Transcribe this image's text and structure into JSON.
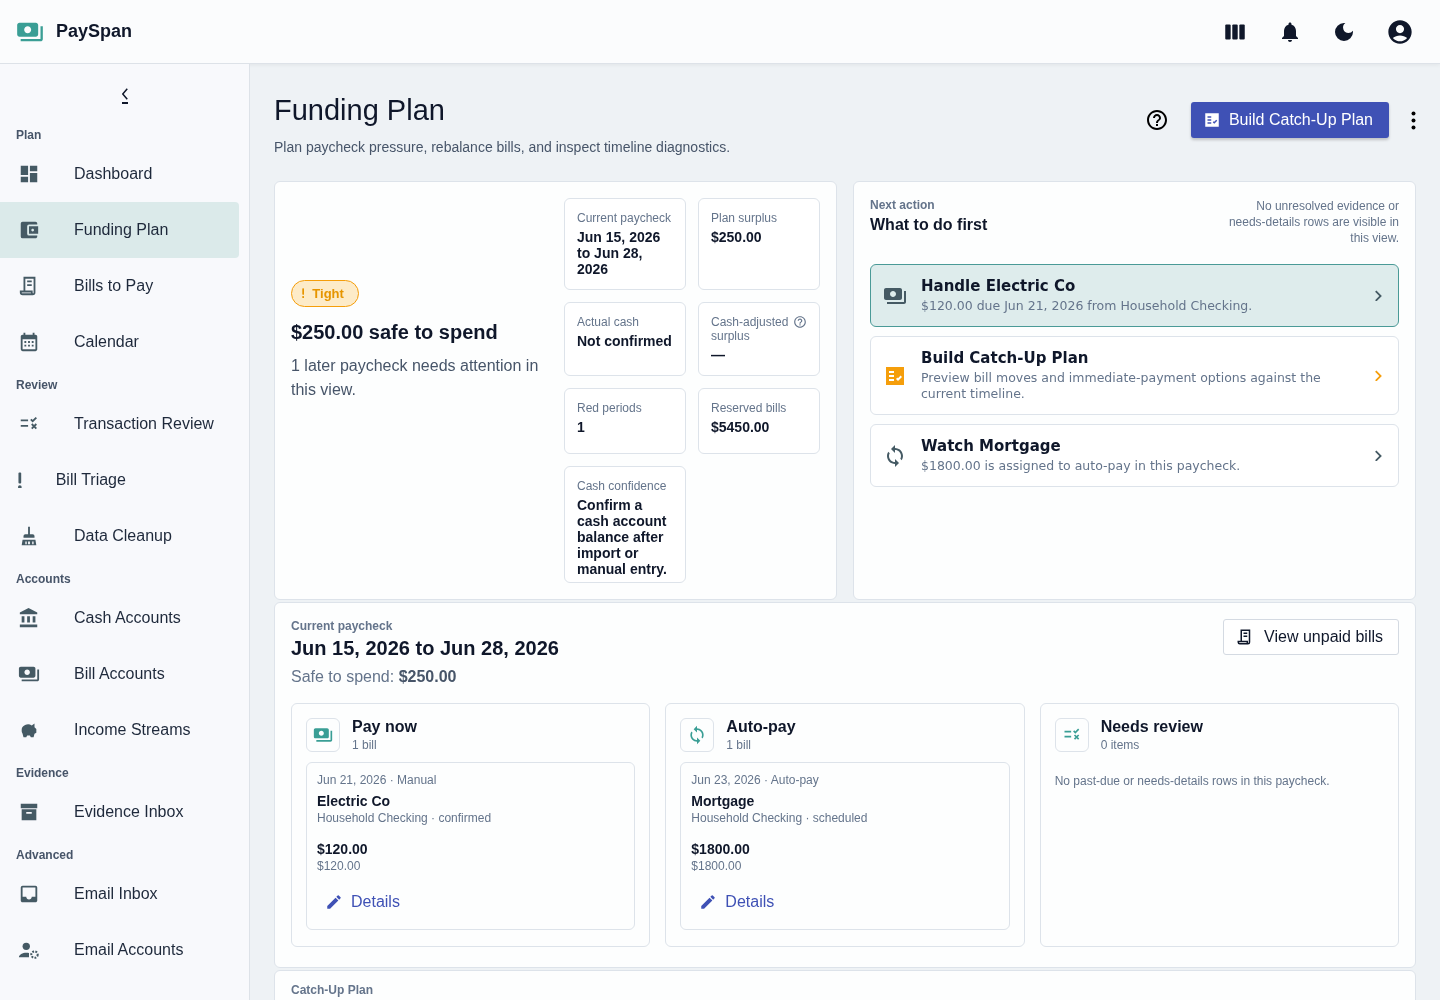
{
  "app": {
    "name": "PaySpan"
  },
  "sidebar": {
    "sections": [
      {
        "label": "Plan",
        "items": [
          {
            "label": "Dashboard",
            "selected": false
          },
          {
            "label": "Funding Plan",
            "selected": true
          },
          {
            "label": "Bills to Pay",
            "selected": false
          },
          {
            "label": "Calendar",
            "selected": false
          }
        ]
      },
      {
        "label": "Review",
        "items": [
          {
            "label": "Transaction Review",
            "selected": false
          },
          {
            "label": "Bill Triage",
            "selected": false
          },
          {
            "label": "Data Cleanup",
            "selected": false
          }
        ]
      },
      {
        "label": "Accounts",
        "items": [
          {
            "label": "Cash Accounts",
            "selected": false
          },
          {
            "label": "Bill Accounts",
            "selected": false
          },
          {
            "label": "Income Streams",
            "selected": false
          }
        ]
      },
      {
        "label": "Evidence",
        "items": [
          {
            "label": "Evidence Inbox",
            "selected": false
          }
        ]
      },
      {
        "label": "Advanced",
        "items": [
          {
            "label": "Email Inbox",
            "selected": false
          },
          {
            "label": "Email Accounts",
            "selected": false
          }
        ]
      }
    ]
  },
  "page": {
    "title": "Funding Plan",
    "subtitle": "Plan paycheck pressure, rebalance bills, and inspect timeline diagnostics.",
    "primary_button": "Build Catch-Up Plan"
  },
  "summary": {
    "status": "Tight",
    "headline": "$250.00 safe to spend",
    "note": "1 later paycheck needs attention in this view.",
    "stats": [
      {
        "label": "Current paycheck",
        "value": "Jun 15, 2026 to Jun 28, 2026",
        "help": false
      },
      {
        "label": "Plan surplus",
        "value": "$250.00",
        "help": false
      },
      {
        "label": "Actual cash",
        "value": "Not confirmed",
        "help": false
      },
      {
        "label": "Cash-adjusted surplus",
        "value": "—",
        "help": true
      },
      {
        "label": "Red periods",
        "value": "1",
        "help": false
      },
      {
        "label": "Reserved bills",
        "value": "$5450.00",
        "help": false
      },
      {
        "label": "Cash confidence",
        "value": "Confirm a cash account balance after import or manual entry.",
        "help": false
      }
    ]
  },
  "next_action": {
    "eyebrow": "Next action",
    "title": "What to do first",
    "note": "No unresolved evidence or needs-details rows are visible in this view.",
    "actions": [
      {
        "kind": "payment",
        "title": "Handle Electric Co",
        "detail": "$120.00 due Jun 21, 2026 from Household Checking.",
        "selected": true
      },
      {
        "kind": "plan",
        "title": "Build Catch-Up Plan",
        "detail": "Preview bill moves and immediate-payment options against the current timeline.",
        "selected": false
      },
      {
        "kind": "autopay",
        "title": "Watch Mortgage",
        "detail": "$1800.00 is assigned to auto-pay in this paycheck.",
        "selected": false
      }
    ]
  },
  "paycheck": {
    "eyebrow": "Current paycheck",
    "title": "Jun 15, 2026 to Jun 28, 2026",
    "safe_label": "Safe to spend:",
    "safe_value": "$250.00",
    "button": "View unpaid bills",
    "lanes": [
      {
        "kind": "payment",
        "title": "Pay now",
        "count": "1 bill",
        "bills": [
          {
            "meta": "Jun 21, 2026 · Manual",
            "name": "Electric Co",
            "account": "Household Checking · confirmed",
            "amount": "$120.00",
            "sub_amount": "$120.00",
            "link": "Details"
          }
        ]
      },
      {
        "kind": "autopay",
        "title": "Auto-pay",
        "count": "1 bill",
        "bills": [
          {
            "meta": "Jun 23, 2026 · Auto-pay",
            "name": "Mortgage",
            "account": "Household Checking · scheduled",
            "amount": "$1800.00",
            "sub_amount": "$1800.00",
            "link": "Details"
          }
        ]
      },
      {
        "kind": "review",
        "title": "Needs review",
        "count": "0 items",
        "empty": "No past-due or needs-details rows in this paycheck."
      }
    ]
  },
  "catch_up": {
    "eyebrow": "Catch-Up Plan"
  }
}
